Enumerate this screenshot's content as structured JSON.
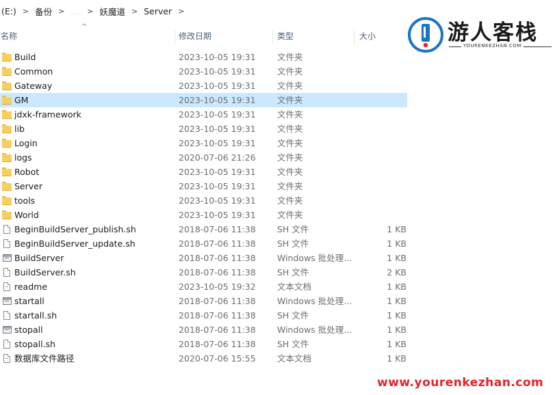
{
  "breadcrumb": {
    "items": [
      "(E:)",
      "备份",
      "...",
      "妖魔道",
      "Server"
    ]
  },
  "columns": {
    "name": "名称",
    "date": "修改日期",
    "type": "类型",
    "size": "大小",
    "sorted_by": "name"
  },
  "files": [
    {
      "name": "Build",
      "date": "2023-10-05 19:31",
      "type": "文件夹",
      "size": "",
      "icon": "folder-icon"
    },
    {
      "name": "Common",
      "date": "2023-10-05 19:31",
      "type": "文件夹",
      "size": "",
      "icon": "folder-icon"
    },
    {
      "name": "Gateway",
      "date": "2023-10-05 19:31",
      "type": "文件夹",
      "size": "",
      "icon": "folder-icon"
    },
    {
      "name": "GM",
      "date": "2023-10-05 19:31",
      "type": "文件夹",
      "size": "",
      "icon": "folder-icon",
      "selected": true
    },
    {
      "name": "jdxk-framework",
      "date": "2023-10-05 19:31",
      "type": "文件夹",
      "size": "",
      "icon": "folder-icon"
    },
    {
      "name": "lib",
      "date": "2023-10-05 19:31",
      "type": "文件夹",
      "size": "",
      "icon": "folder-icon"
    },
    {
      "name": "Login",
      "date": "2023-10-05 19:31",
      "type": "文件夹",
      "size": "",
      "icon": "folder-icon"
    },
    {
      "name": "logs",
      "date": "2020-07-06 21:26",
      "type": "文件夹",
      "size": "",
      "icon": "folder-icon"
    },
    {
      "name": "Robot",
      "date": "2023-10-05 19:31",
      "type": "文件夹",
      "size": "",
      "icon": "folder-icon"
    },
    {
      "name": "Server",
      "date": "2023-10-05 19:31",
      "type": "文件夹",
      "size": "",
      "icon": "folder-icon"
    },
    {
      "name": "tools",
      "date": "2023-10-05 19:31",
      "type": "文件夹",
      "size": "",
      "icon": "folder-icon"
    },
    {
      "name": "World",
      "date": "2023-10-05 19:31",
      "type": "文件夹",
      "size": "",
      "icon": "folder-icon"
    },
    {
      "name": "BeginBuildServer_publish.sh",
      "date": "2018-07-06 11:38",
      "type": "SH 文件",
      "size": "1 KB",
      "icon": "file-icon"
    },
    {
      "name": "BeginBuildServer_update.sh",
      "date": "2018-07-06 11:38",
      "type": "SH 文件",
      "size": "1 KB",
      "icon": "file-icon"
    },
    {
      "name": "BuildServer",
      "date": "2018-07-06 11:38",
      "type": "Windows 批处理...",
      "size": "1 KB",
      "icon": "batch-file-icon"
    },
    {
      "name": "BuildServer.sh",
      "date": "2018-07-06 11:38",
      "type": "SH 文件",
      "size": "2 KB",
      "icon": "file-icon"
    },
    {
      "name": "readme",
      "date": "2023-10-05 19:32",
      "type": "文本文档",
      "size": "1 KB",
      "icon": "text-file-icon"
    },
    {
      "name": "startall",
      "date": "2018-07-06 11:38",
      "type": "Windows 批处理...",
      "size": "1 KB",
      "icon": "batch-file-icon"
    },
    {
      "name": "startall.sh",
      "date": "2018-07-06 11:38",
      "type": "SH 文件",
      "size": "1 KB",
      "icon": "file-icon"
    },
    {
      "name": "stopall",
      "date": "2018-07-06 11:38",
      "type": "Windows 批处理...",
      "size": "1 KB",
      "icon": "batch-file-icon"
    },
    {
      "name": "stopall.sh",
      "date": "2018-07-06 11:38",
      "type": "SH 文件",
      "size": "1 KB",
      "icon": "file-icon"
    },
    {
      "name": "数据库文件路径",
      "date": "2020-07-06 15:55",
      "type": "文本文档",
      "size": "1 KB",
      "icon": "text-file-icon"
    }
  ],
  "watermark": {
    "title": "游人客栈",
    "subtitle": "YOURENKEZHAN.COM",
    "url": "www.yourenkezhan.com",
    "colors": {
      "badge": "#1b74c4",
      "url": "#e8202a"
    }
  }
}
